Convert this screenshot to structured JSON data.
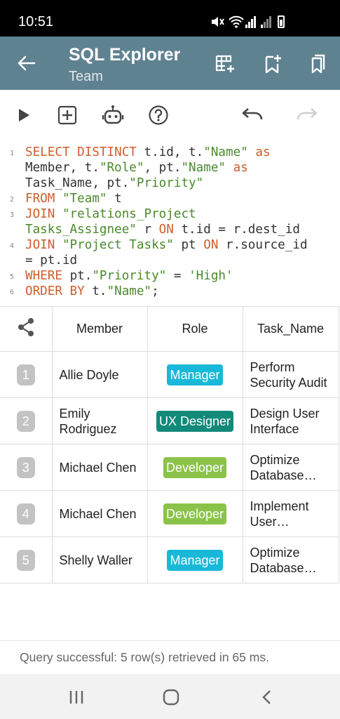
{
  "status_bar": {
    "time": "10:51"
  },
  "app_bar": {
    "title": "SQL Explorer",
    "subtitle": "Team"
  },
  "toolbar": {
    "buttons": [
      "run-icon",
      "add-box-icon",
      "robot-icon",
      "help-icon",
      "undo-icon",
      "redo-icon"
    ]
  },
  "editor": {
    "line_numbers": [
      "1",
      "2",
      "3",
      "4",
      "5",
      "6"
    ],
    "lines": [
      [
        {
          "t": "kw",
          "v": "SELECT DISTINCT "
        },
        {
          "t": "pl",
          "v": "t.id, t."
        },
        {
          "t": "str",
          "v": "\"Name\""
        },
        {
          "t": "kw",
          "v": " as"
        }
      ],
      [
        {
          "t": "pl",
          "v": "Member, t."
        },
        {
          "t": "str",
          "v": "\"Role\""
        },
        {
          "t": "pl",
          "v": ", pt."
        },
        {
          "t": "str",
          "v": "\"Name\""
        },
        {
          "t": "kw",
          "v": " as"
        }
      ],
      [
        {
          "t": "pl",
          "v": "Task_Name, pt."
        },
        {
          "t": "str",
          "v": "\"Priority\""
        }
      ],
      [
        {
          "t": "kw",
          "v": "FROM "
        },
        {
          "t": "str",
          "v": "\"Team\""
        },
        {
          "t": "pl",
          "v": " t"
        }
      ],
      [
        {
          "t": "kw",
          "v": "JOIN "
        },
        {
          "t": "str",
          "v": "\"relations_Project"
        }
      ],
      [
        {
          "t": "str",
          "v": "Tasks_Assignee\""
        },
        {
          "t": "pl",
          "v": " r "
        },
        {
          "t": "kw",
          "v": "ON"
        },
        {
          "t": "pl",
          "v": " t.id = r.dest_id"
        }
      ],
      [
        {
          "t": "kw",
          "v": "JOIN "
        },
        {
          "t": "str",
          "v": "\"Project Tasks\""
        },
        {
          "t": "pl",
          "v": " pt "
        },
        {
          "t": "kw",
          "v": "ON"
        },
        {
          "t": "pl",
          "v": " r.source_id"
        }
      ],
      [
        {
          "t": "pl",
          "v": "= pt.id"
        }
      ],
      [
        {
          "t": "kw",
          "v": "WHERE "
        },
        {
          "t": "pl",
          "v": "pt."
        },
        {
          "t": "str",
          "v": "\"Priority\""
        },
        {
          "t": "pl",
          "v": " = "
        },
        {
          "t": "str",
          "v": "'High'"
        }
      ],
      [
        {
          "t": "kw",
          "v": "ORDER BY "
        },
        {
          "t": "pl",
          "v": "t."
        },
        {
          "t": "str",
          "v": "\"Name\""
        },
        {
          "t": "pl",
          "v": ";"
        }
      ]
    ]
  },
  "table": {
    "columns": [
      "Member",
      "Role",
      "Task_Name"
    ],
    "rows": [
      {
        "idx": "1",
        "member": "Allie Doyle",
        "role": "Manager",
        "role_color": "#1ab8d8",
        "task": "Perform Security Audit"
      },
      {
        "idx": "2",
        "member": "Emily Rodriguez",
        "role": "UX Designer",
        "role_color": "#13897a",
        "task": "Design User Interface"
      },
      {
        "idx": "3",
        "member": "Michael Chen",
        "role": "Developer",
        "role_color": "#8bc34a",
        "task": "Optimize Database Queries"
      },
      {
        "idx": "4",
        "member": "Michael Chen",
        "role": "Developer",
        "role_color": "#8bc34a",
        "task": "Implement User Authentication"
      },
      {
        "idx": "5",
        "member": "Shelly Waller",
        "role": "Manager",
        "role_color": "#1ab8d8",
        "task": "Optimize Database Queries"
      }
    ]
  },
  "query_status": "Query successful: 5 row(s) retrieved in 65 ms.",
  "colors": {
    "app_bar": "#5f8291",
    "keyword": "#cf5d2c",
    "string": "#4a8a2a"
  }
}
